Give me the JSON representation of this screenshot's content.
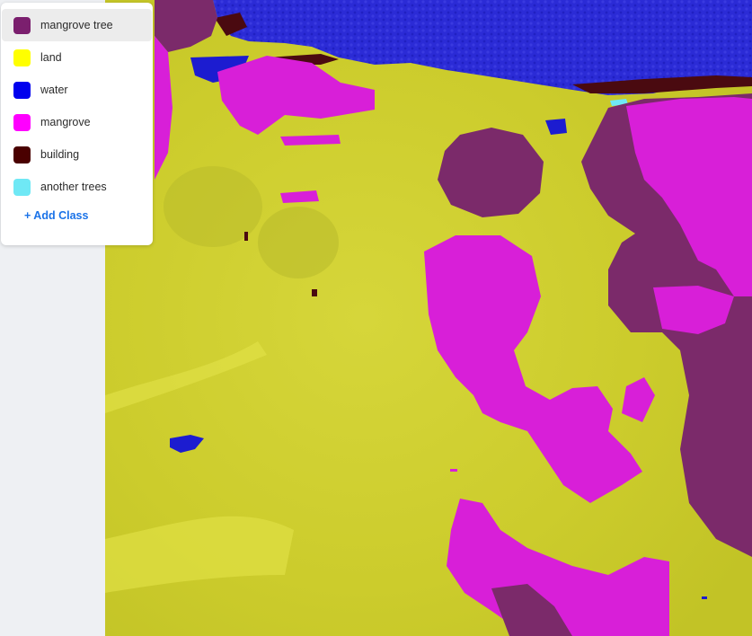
{
  "classes_panel": {
    "items": [
      {
        "label": "mangrove tree",
        "color": "#7b1f6e",
        "selected": true
      },
      {
        "label": "land",
        "color": "#ffff00",
        "selected": false
      },
      {
        "label": "water",
        "color": "#0000ee",
        "selected": false
      },
      {
        "label": "mangrove",
        "color": "#ff00ff",
        "selected": false
      },
      {
        "label": "building",
        "color": "#4a0000",
        "selected": false
      },
      {
        "label": "another trees",
        "color": "#6fe8f5",
        "selected": false
      }
    ],
    "add_class_label": "+ Add Class"
  },
  "canvas": {
    "accent_color": "#1b73e8"
  }
}
